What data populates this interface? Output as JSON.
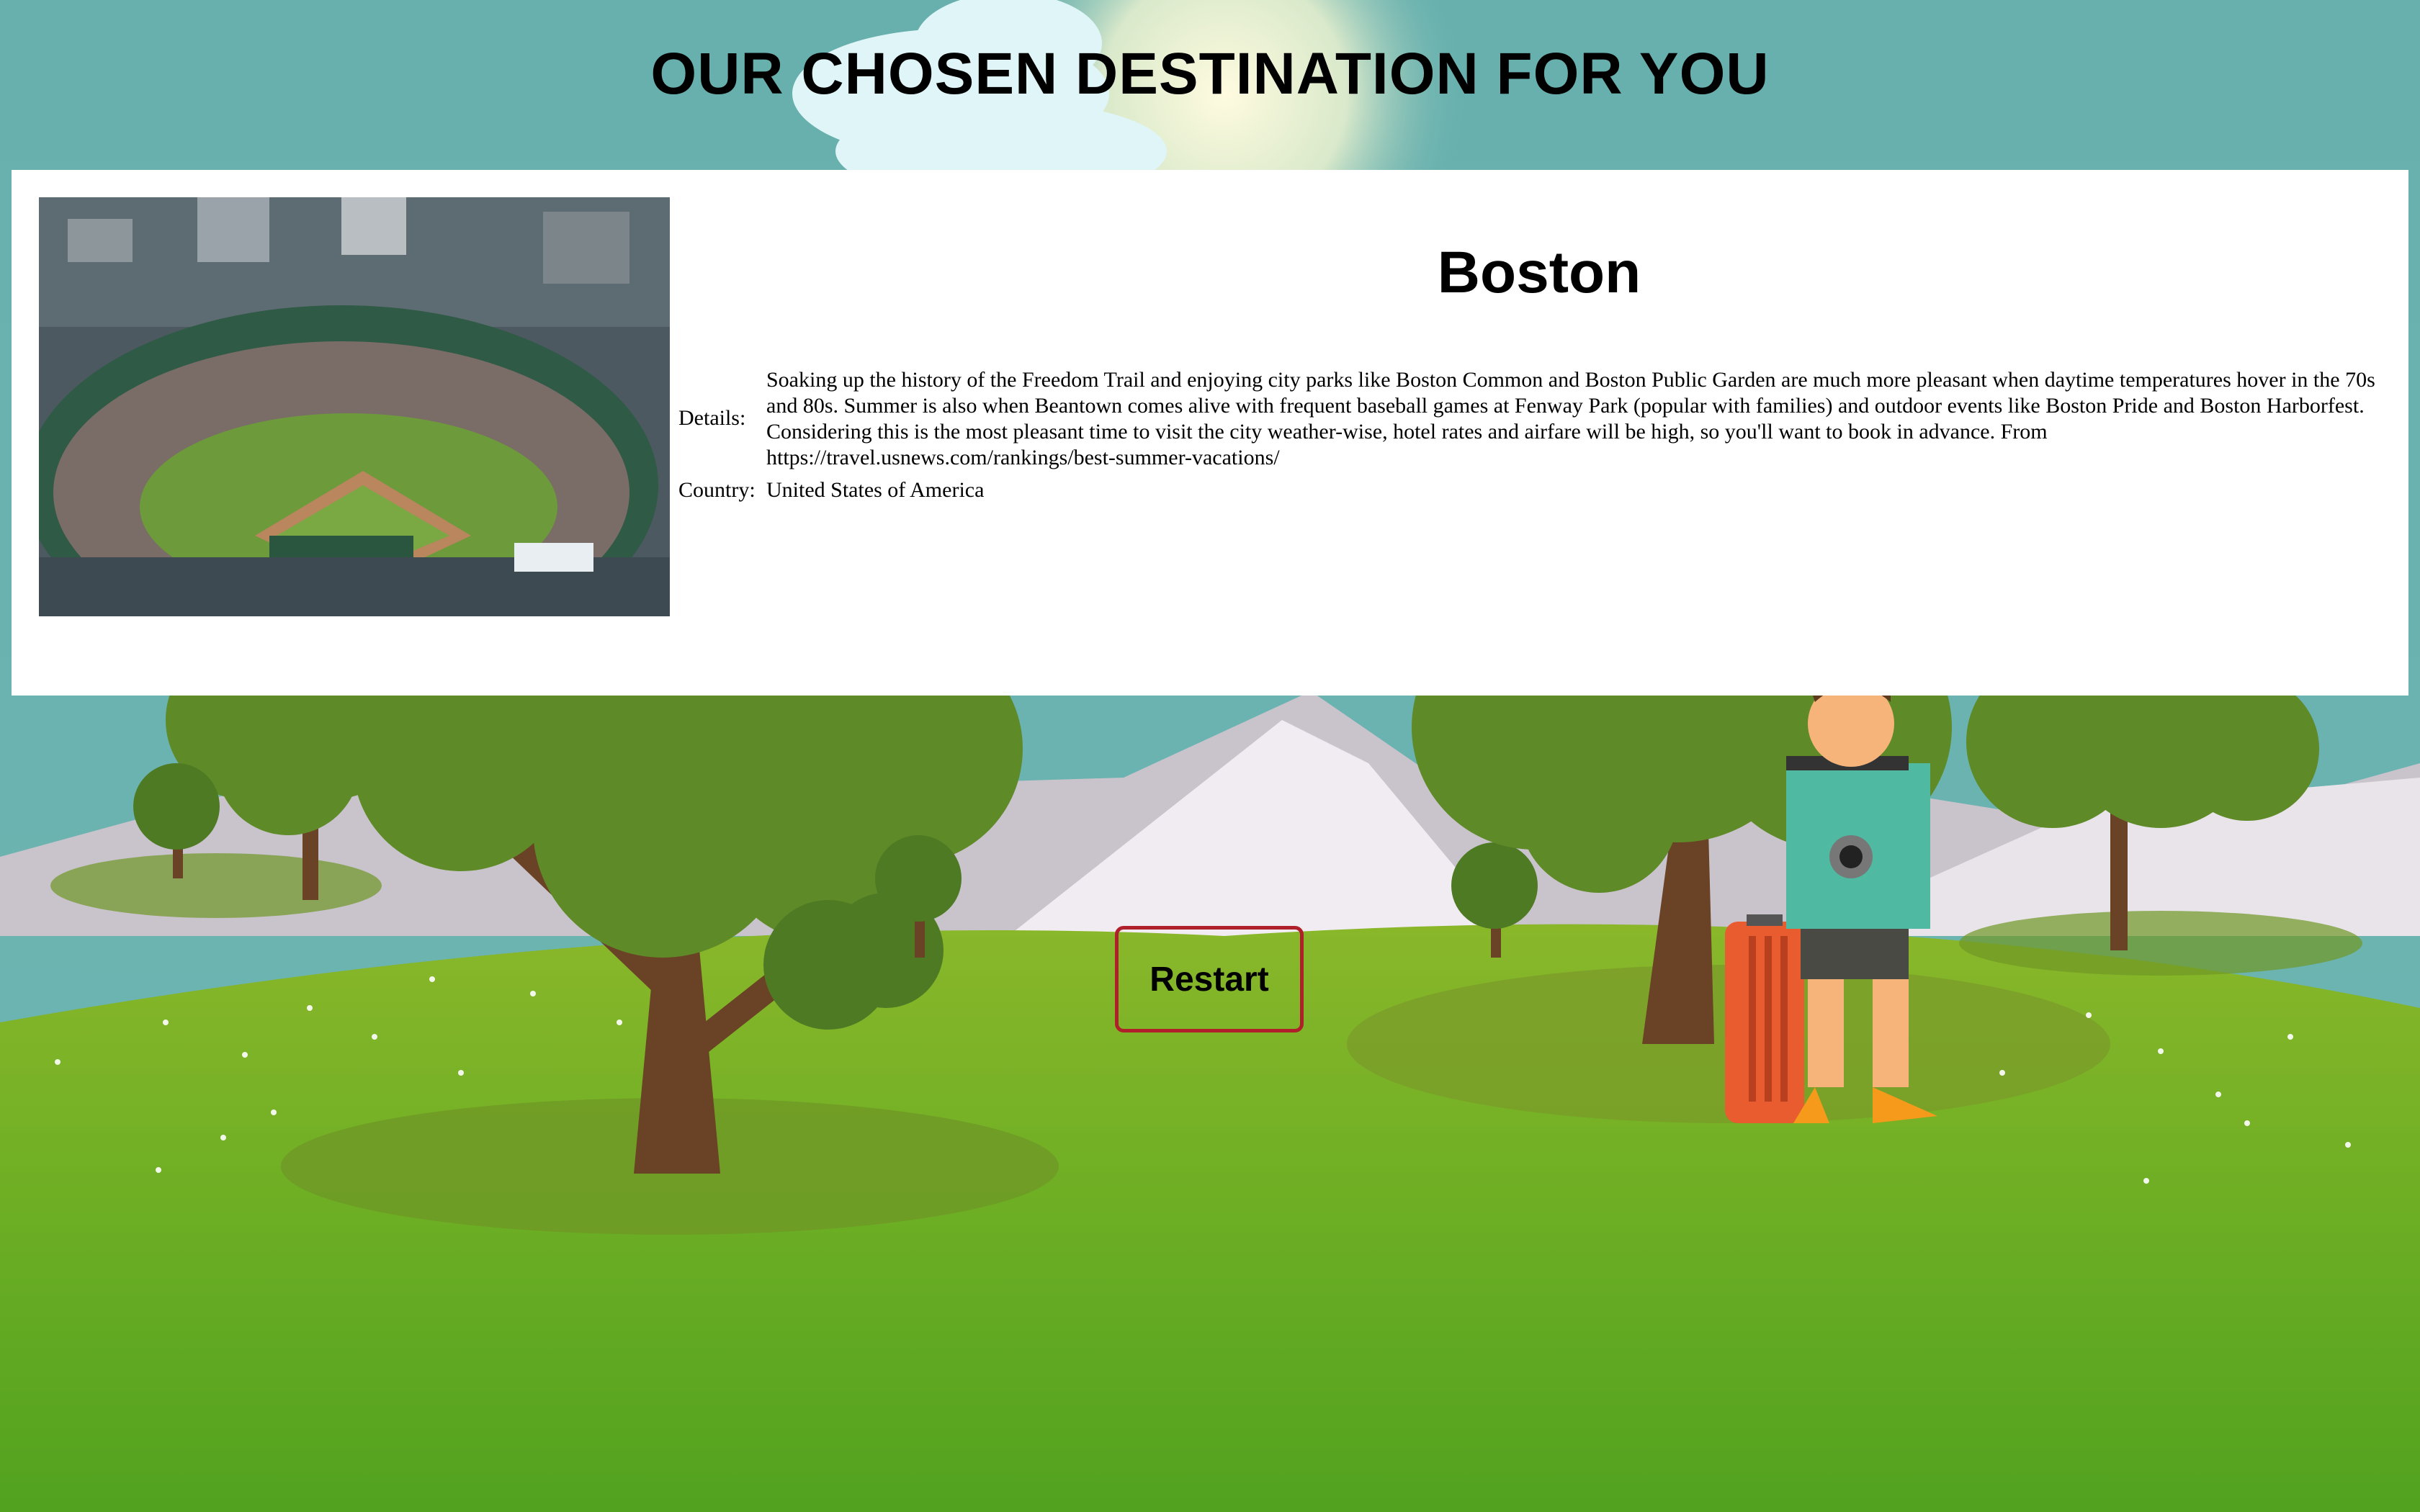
{
  "page": {
    "title": "OUR CHOSEN DESTINATION FOR YOU"
  },
  "destination": {
    "name": "Boston",
    "details_label": "Details:",
    "details": "Soaking up the history of the Freedom Trail and enjoying city parks like Boston Common and Boston Public Garden are much more pleasant when daytime temperatures hover in the 70s and 80s. Summer is also when Beantown comes alive with frequent baseball games at Fenway Park (popular with families) and outdoor events like Boston Pride and Boston Harborfest. Considering this is the most pleasant time to visit the city weather-wise, hotel rates and airfare will be high, so you'll want to book in advance. From https://travel.usnews.com/rankings/best-summer-vacations/",
    "country_label": "Country:",
    "country": "United States of America",
    "image_label": "stadium-photo"
  },
  "actions": {
    "restart_label": "Restart"
  },
  "colors": {
    "sky": "#67b0ae",
    "grass": "#5aa82a",
    "tree": "#5f8a28",
    "trunk": "#6a4226",
    "button_border": "#b0202a"
  }
}
